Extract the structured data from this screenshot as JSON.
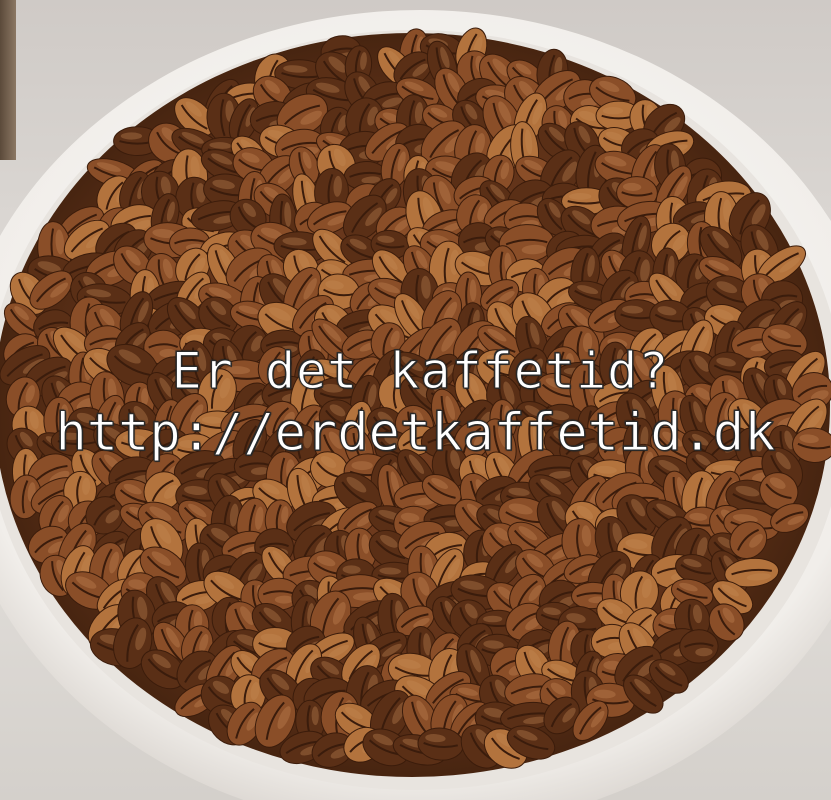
{
  "photo": {
    "subject": "coffee-beans-in-white-bowl",
    "colors": {
      "bowl": "#f4f2ef",
      "bowl_shadow": "#cfc9c3",
      "bean_dark": "#5a2f16",
      "bean_mid": "#8a4e28",
      "bean_light": "#b3733d",
      "crease": "#3a1c0c",
      "background": "#d9d6d2"
    }
  },
  "watermark": {
    "line1": "Er det kaffetid?",
    "line2": "http://erdetkaffetid.dk"
  }
}
